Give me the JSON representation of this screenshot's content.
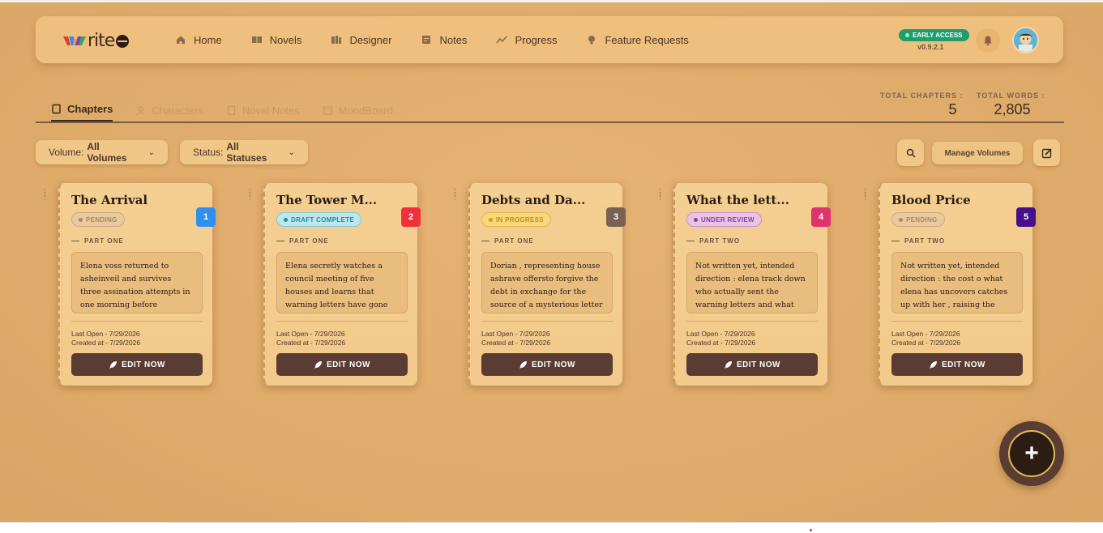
{
  "nav": {
    "logo_text": "rite",
    "items": [
      {
        "label": "Home",
        "icon": "home-icon"
      },
      {
        "label": "Novels",
        "icon": "book-icon"
      },
      {
        "label": "Designer",
        "icon": "designer-icon"
      },
      {
        "label": "Notes",
        "icon": "notes-icon"
      },
      {
        "label": "Progress",
        "icon": "progress-icon"
      },
      {
        "label": "Feature Requests",
        "icon": "lightbulb-icon"
      }
    ],
    "badge": "EARLY ACCESS",
    "version": "v0.9.2.1"
  },
  "tabs": [
    {
      "label": "Chapters",
      "active": true
    },
    {
      "label": "Characters",
      "active": false
    },
    {
      "label": "Novel Notes",
      "active": false
    },
    {
      "label": "MoodBoard",
      "active": false
    }
  ],
  "stats": {
    "chapters_label": "TOTAL CHAPTERS :",
    "chapters_value": "5",
    "words_label": "TOTAL WORDS :",
    "words_value": "2,805"
  },
  "filters": {
    "volume_label": "Volume:",
    "volume_value": "All Volumes",
    "status_label": "Status:",
    "status_value": "All Statuses",
    "manage_label": "Manage Volumes"
  },
  "colors": {
    "accent_dark": "#5a3c32",
    "badge_1": "#2f8ff0",
    "badge_2": "#f0303a",
    "badge_3": "#7a6252",
    "badge_4": "#e0336e",
    "badge_5": "#46108a"
  },
  "chapters": [
    {
      "number": "1",
      "title": "The Arrival",
      "status": "PENDING",
      "part": "PART ONE",
      "summary": "Elena voss returned to asheinveil and survives three assination attempts in one morning before confroning...",
      "last_open": "Last Open - 7/29/2026",
      "created": "Created at - 7/29/2026",
      "edit_label": "EDIT NOW"
    },
    {
      "number": "2",
      "title": "The Tower M...",
      "status": "DRAFT COMPLETE",
      "part": "PART ONE",
      "summary": "Elena secretly watches a council meeting of five houses and learns that warning letters have gone out suggesting the...",
      "last_open": "Last Open - 7/29/2026",
      "created": "Created at - 7/29/2026",
      "edit_label": "EDIT NOW"
    },
    {
      "number": "3",
      "title": "Debts and Da...",
      "status": "IN PROGRESS",
      "part": "PART ONE",
      "summary": "Dorian , representing house ashrave offersto forgive the debt in exchange for the source of a mysterious letter ,...",
      "last_open": "Last Open - 7/29/2026",
      "created": "Created at - 7/29/2026",
      "edit_label": "EDIT NOW"
    },
    {
      "number": "4",
      "title": "What the lett...",
      "status": "UNDER REVIEW",
      "part": "PART TWO",
      "summary": "Not written yet, intended direction : elena track down who actually sent the warning letters and what they reveal...",
      "last_open": "Last Open - 7/29/2026",
      "created": "Created at - 7/29/2026",
      "edit_label": "EDIT NOW"
    },
    {
      "number": "5",
      "title": "Blood Price",
      "status": "PENDING",
      "part": "PART TWO",
      "summary": "Not written yet, intended direction : the cost o what elena has uncovers catches up with her , raising the stakes...",
      "last_open": "Last Open - 7/29/2026",
      "created": "Created at - 7/29/2026",
      "edit_label": "EDIT NOW"
    }
  ],
  "fab_label": "+"
}
